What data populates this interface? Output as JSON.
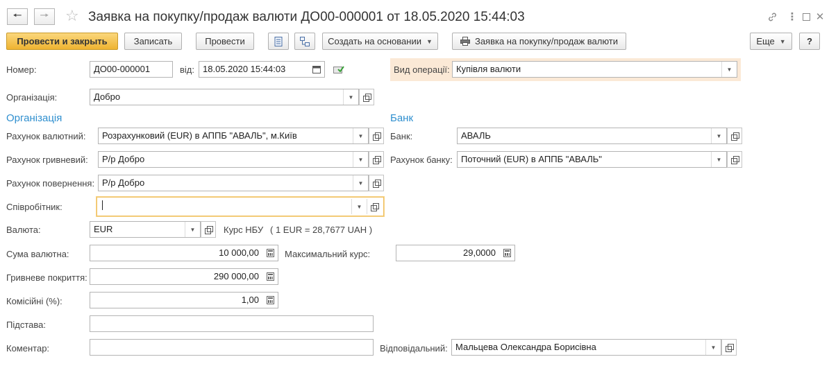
{
  "window": {
    "title": "Заявка на покупку/продаж валюти ДО00-000001 от 18.05.2020 15:44:03"
  },
  "toolbar": {
    "post_close": "Провести и закрыть",
    "save": "Записать",
    "post": "Провести",
    "create_based": "Создать на основании",
    "print_request": "Заявка на покупку/продаж валюти",
    "more": "Еще",
    "help": "?"
  },
  "form": {
    "number": {
      "label": "Номер:",
      "value": "ДО00-000001"
    },
    "date": {
      "label": "від:",
      "value": "18.05.2020 15:44:03"
    },
    "operation": {
      "label": "Вид операції:",
      "value": "Купівля валюти"
    },
    "organization": {
      "label": "Організація:",
      "value": "Добро"
    },
    "section_org": "Організація",
    "section_bank": "Банк",
    "currency_account": {
      "label": "Рахунок валютний:",
      "value": "Розрахунковий (EUR) в АППБ \"АВАЛЬ\", м.Київ"
    },
    "uah_account": {
      "label": "Рахунок гривневий:",
      "value": "Р/р Добро"
    },
    "return_account": {
      "label": "Рахунок повернення:",
      "value": "Р/р Добро"
    },
    "employee": {
      "label": "Співробітник:",
      "value": ""
    },
    "bank": {
      "label": "Банк:",
      "value": "АВАЛЬ"
    },
    "bank_account": {
      "label": "Рахунок банку:",
      "value": "Поточний (EUR) в АППБ \"АВАЛЬ\""
    },
    "currency": {
      "label": "Валюта:",
      "value": "EUR"
    },
    "nbu_rate": {
      "label": "Курс НБУ",
      "value": "( 1 EUR = 28,7677 UAH )"
    },
    "currency_amount": {
      "label": "Сума валютна:",
      "value": "10 000,00"
    },
    "max_rate": {
      "label": "Максимальний курс:",
      "value": "29,0000"
    },
    "uah_coverage": {
      "label": "Гривневе покриття:",
      "value": "290 000,00"
    },
    "commission": {
      "label": "Комісійні (%):",
      "value": "1,00"
    },
    "basis": {
      "label": "Підстава:",
      "value": ""
    },
    "comment": {
      "label": "Коментар:",
      "value": ""
    },
    "responsible": {
      "label": "Відповідальний:",
      "value": "Мальцева Олександра Борисівна"
    }
  },
  "colors": {
    "primary_button": "#eeb331",
    "section_header": "#2f8fcf",
    "operation_highlight": "#fbe9d6",
    "focus_border": "#f0c060"
  }
}
